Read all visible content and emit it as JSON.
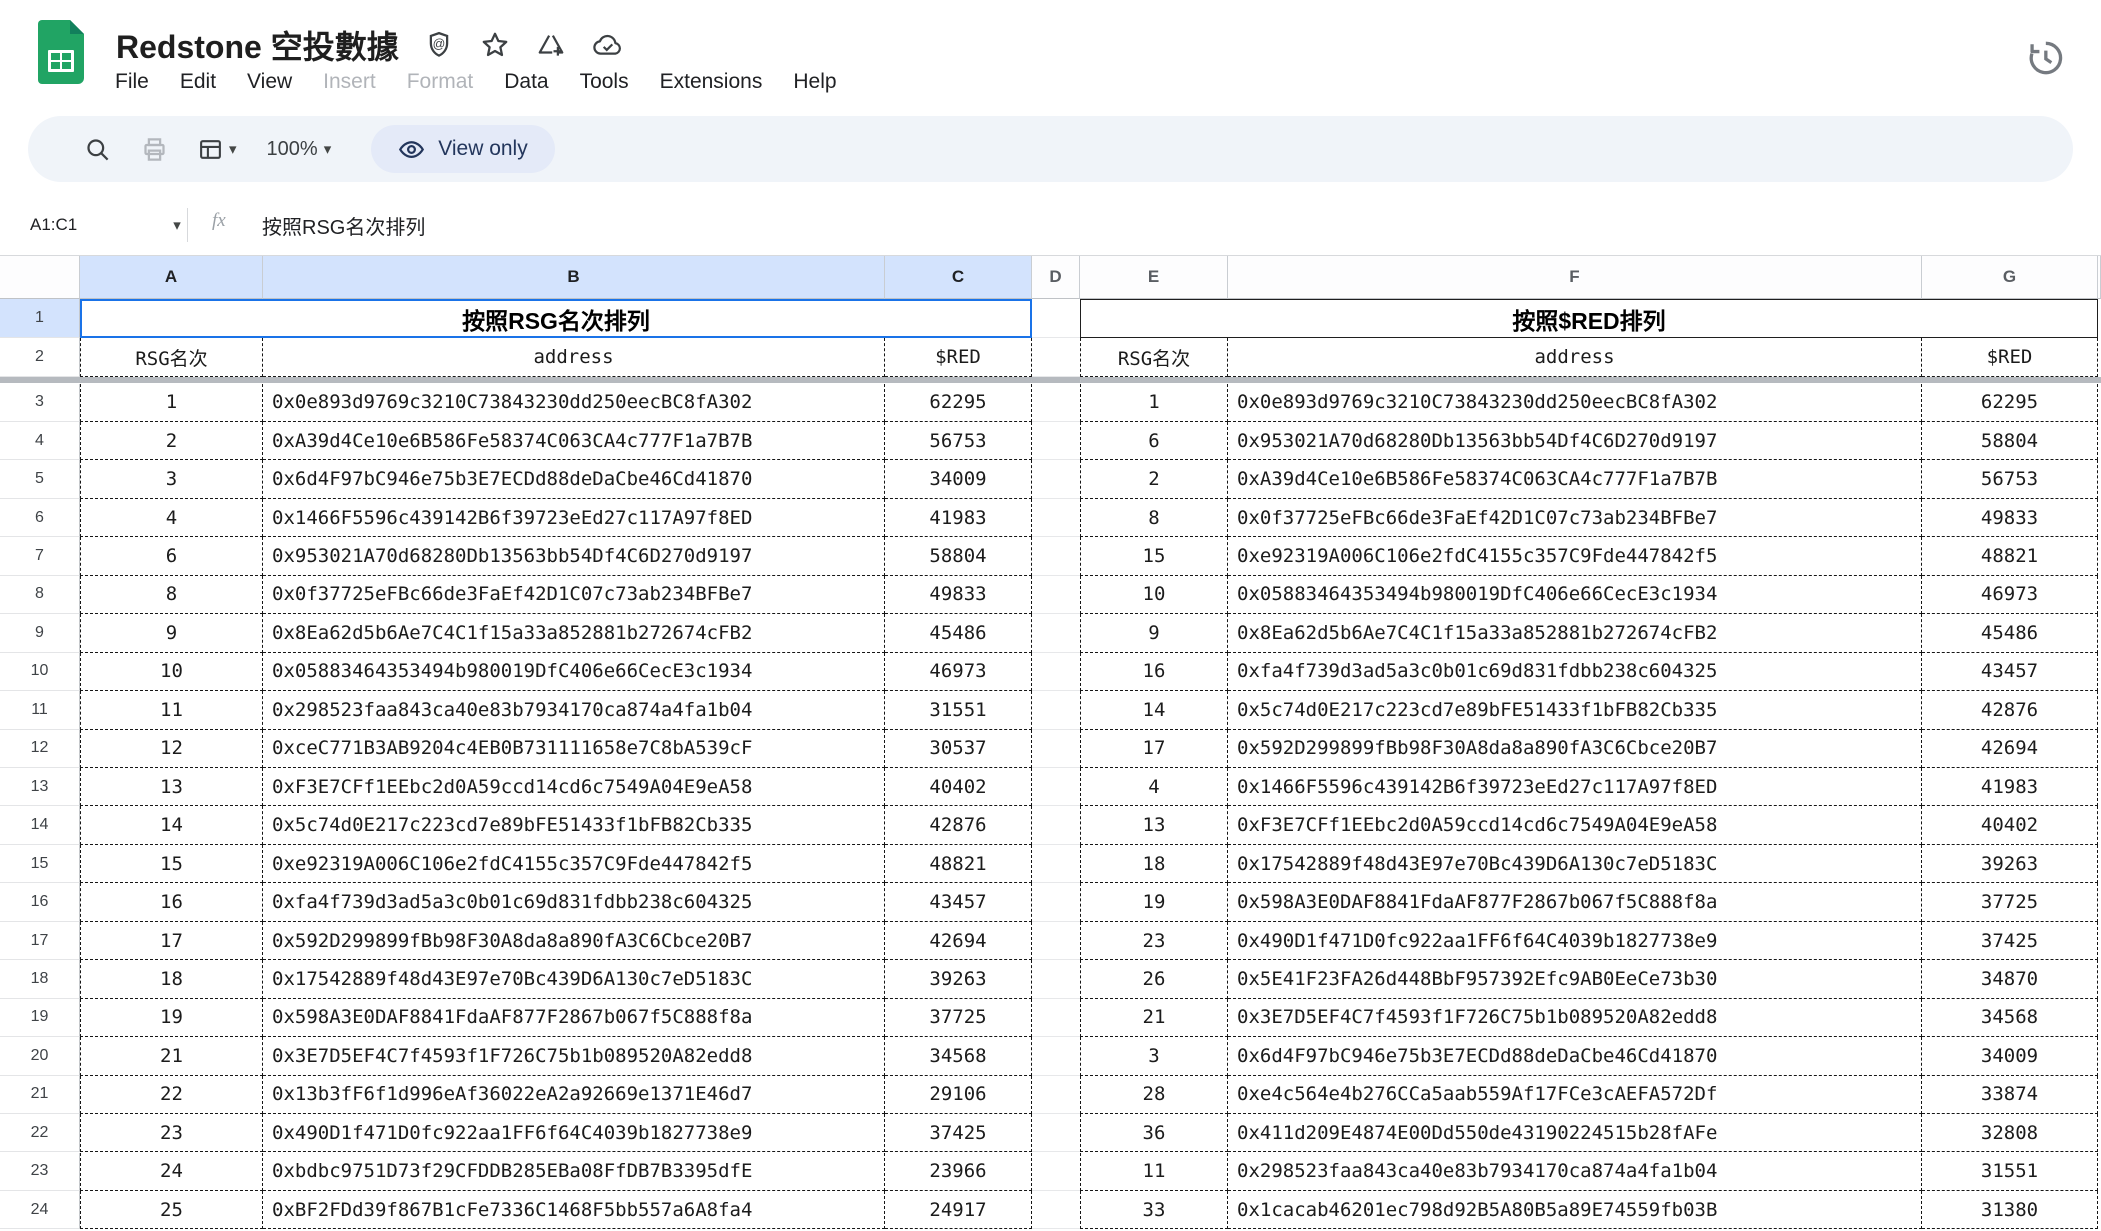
{
  "app": {
    "title": "Redstone 空投數據",
    "menu": {
      "items": [
        {
          "label": "File",
          "enabled": true
        },
        {
          "label": "Edit",
          "enabled": true
        },
        {
          "label": "View",
          "enabled": true
        },
        {
          "label": "Insert",
          "enabled": false
        },
        {
          "label": "Format",
          "enabled": false
        },
        {
          "label": "Data",
          "enabled": true
        },
        {
          "label": "Tools",
          "enabled": true
        },
        {
          "label": "Extensions",
          "enabled": true
        },
        {
          "label": "Help",
          "enabled": true
        }
      ]
    },
    "title_icons": [
      "badge-icon",
      "star-icon",
      "add-shortcut-icon",
      "cloud-check-icon"
    ],
    "version_history_icon": "history-icon"
  },
  "toolbar": {
    "zoom_level": "100%",
    "view_only_label": "View only",
    "icons": [
      "search-icon",
      "print-icon",
      "filter-views-icon"
    ]
  },
  "formula_bar": {
    "name_box": "A1:C1",
    "formula": "按照RSG名次排列"
  },
  "grid": {
    "column_headers": [
      "A",
      "B",
      "C",
      "D",
      "E",
      "F",
      "G"
    ],
    "selected_columns": [
      "A",
      "B",
      "C"
    ],
    "selected_row_headers": [
      1
    ],
    "row_numbers": [
      1,
      2,
      3,
      4,
      5,
      6,
      7,
      8,
      9,
      10,
      11,
      12,
      13,
      14,
      15,
      16,
      17,
      18,
      19,
      20,
      21,
      22,
      23,
      24
    ],
    "frozen_rows": 2
  },
  "left_table": {
    "title": "按照RSG名次排列",
    "headers": [
      "RSG名次",
      "address",
      "$RED"
    ],
    "rows": [
      [
        1,
        "0x0e893d9769c3210C73843230dd250eecBC8fA302",
        62295
      ],
      [
        2,
        "0xA39d4Ce10e6B586Fe58374C063CA4c777F1a7B7B",
        56753
      ],
      [
        3,
        "0x6d4F97bC946e75b3E7ECDd88deDaCbe46Cd41870",
        34009
      ],
      [
        4,
        "0x1466F5596c439142B6f39723eEd27c117A97f8ED",
        41983
      ],
      [
        6,
        "0x953021A70d68280Db13563bb54Df4C6D270d9197",
        58804
      ],
      [
        8,
        "0x0f37725eFBc66de3FaEf42D1C07c73ab234BFBe7",
        49833
      ],
      [
        9,
        "0x8Ea62d5b6Ae7C4C1f15a33a852881b272674cFB2",
        45486
      ],
      [
        10,
        "0x05883464353494b980019DfC406e66CecE3c1934",
        46973
      ],
      [
        11,
        "0x298523faa843ca40e83b7934170ca874a4fa1b04",
        31551
      ],
      [
        12,
        "0xceC771B3AB9204c4EB0B731111658e7C8bA539cF",
        30537
      ],
      [
        13,
        "0xF3E7CFf1EEbc2d0A59ccd14cd6c7549A04E9eA58",
        40402
      ],
      [
        14,
        "0x5c74d0E217c223cd7e89bFE51433f1bFB82Cb335",
        42876
      ],
      [
        15,
        "0xe92319A006C106e2fdC4155c357C9Fde447842f5",
        48821
      ],
      [
        16,
        "0xfa4f739d3ad5a3c0b01c69d831fdbb238c604325",
        43457
      ],
      [
        17,
        "0x592D299899fBb98F30A8da8a890fA3C6Cbce20B7",
        42694
      ],
      [
        18,
        "0x17542889f48d43E97e70Bc439D6A130c7eD5183C",
        39263
      ],
      [
        19,
        "0x598A3E0DAF8841FdaAF877F2867b067f5C888f8a",
        37725
      ],
      [
        21,
        "0x3E7D5EF4C7f4593f1F726C75b1b089520A82edd8",
        34568
      ],
      [
        22,
        "0x13b3fF6f1d996eAf36022eA2a92669e1371E46d7",
        29106
      ],
      [
        23,
        "0x490D1f471D0fc922aa1FF6f64C4039b1827738e9",
        37425
      ],
      [
        24,
        "0xbdbc9751D73f29CFDDB285EBa08FfDB7B3395dfE",
        23966
      ],
      [
        25,
        "0xBF2FDd39f867B1cFe7336C1468F5bb557a6A8fa4",
        24917
      ]
    ]
  },
  "right_table": {
    "title": "按照$RED排列",
    "headers": [
      "RSG名次",
      "address",
      "$RED"
    ],
    "rows": [
      [
        1,
        "0x0e893d9769c3210C73843230dd250eecBC8fA302",
        62295
      ],
      [
        6,
        "0x953021A70d68280Db13563bb54Df4C6D270d9197",
        58804
      ],
      [
        2,
        "0xA39d4Ce10e6B586Fe58374C063CA4c777F1a7B7B",
        56753
      ],
      [
        8,
        "0x0f37725eFBc66de3FaEf42D1C07c73ab234BFBe7",
        49833
      ],
      [
        15,
        "0xe92319A006C106e2fdC4155c357C9Fde447842f5",
        48821
      ],
      [
        10,
        "0x05883464353494b980019DfC406e66CecE3c1934",
        46973
      ],
      [
        9,
        "0x8Ea62d5b6Ae7C4C1f15a33a852881b272674cFB2",
        45486
      ],
      [
        16,
        "0xfa4f739d3ad5a3c0b01c69d831fdbb238c604325",
        43457
      ],
      [
        14,
        "0x5c74d0E217c223cd7e89bFE51433f1bFB82Cb335",
        42876
      ],
      [
        17,
        "0x592D299899fBb98F30A8da8a890fA3C6Cbce20B7",
        42694
      ],
      [
        4,
        "0x1466F5596c439142B6f39723eEd27c117A97f8ED",
        41983
      ],
      [
        13,
        "0xF3E7CFf1EEbc2d0A59ccd14cd6c7549A04E9eA58",
        40402
      ],
      [
        18,
        "0x17542889f48d43E97e70Bc439D6A130c7eD5183C",
        39263
      ],
      [
        19,
        "0x598A3E0DAF8841FdaAF877F2867b067f5C888f8a",
        37725
      ],
      [
        23,
        "0x490D1f471D0fc922aa1FF6f64C4039b1827738e9",
        37425
      ],
      [
        26,
        "0x5E41F23FA26d448BbF957392Efc9AB0EeCe73b30",
        34870
      ],
      [
        21,
        "0x3E7D5EF4C7f4593f1F726C75b1b089520A82edd8",
        34568
      ],
      [
        3,
        "0x6d4F97bC946e75b3E7ECDd88deDaCbe46Cd41870",
        34009
      ],
      [
        28,
        "0xe4c564e4b276CCa5aab559Af17FCe3cAEFA572Df",
        33874
      ],
      [
        36,
        "0x411d209E4874E00Dd550de43190224515b28fAFe",
        32808
      ],
      [
        11,
        "0x298523faa843ca40e83b7934170ca874a4fa1b04",
        31551
      ],
      [
        33,
        "0x1cacab46201ec798d92B5A80B5a89E74559fb03B",
        31380
      ]
    ]
  },
  "colors": {
    "selection_blue": "#1a73e8",
    "selected_header_bg": "#d3e3fd",
    "toolbar_bg": "#f0f4f9",
    "view_only_chip_bg": "#e4eaf8",
    "logo_green": "#21a464",
    "dashed_border": "#161616"
  }
}
